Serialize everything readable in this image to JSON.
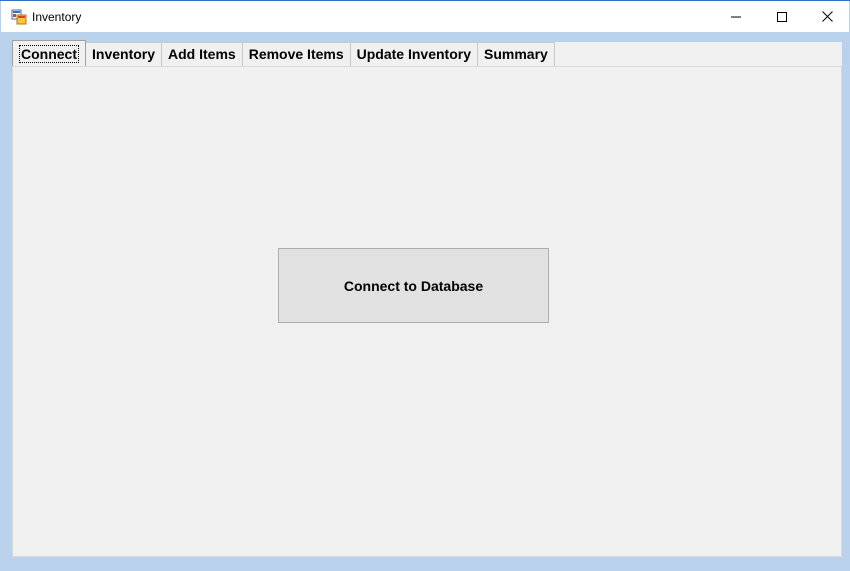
{
  "window": {
    "title": "Inventory",
    "app_icon": "winforms-app-icon",
    "controls": {
      "minimize_icon": "minimize-icon",
      "maximize_icon": "maximize-icon",
      "close_icon": "close-icon"
    }
  },
  "tabs": [
    {
      "label": "Connect",
      "active": true
    },
    {
      "label": "Inventory",
      "active": false
    },
    {
      "label": "Add Items",
      "active": false
    },
    {
      "label": "Remove Items",
      "active": false
    },
    {
      "label": "Update Inventory",
      "active": false
    },
    {
      "label": "Summary",
      "active": false
    }
  ],
  "connect_panel": {
    "button_label": "Connect to Database"
  },
  "colors": {
    "frame": "#b9d1ea",
    "panel": "#f0f0f0",
    "button": "#e1e1e1",
    "titlebar": "#ffffff"
  }
}
